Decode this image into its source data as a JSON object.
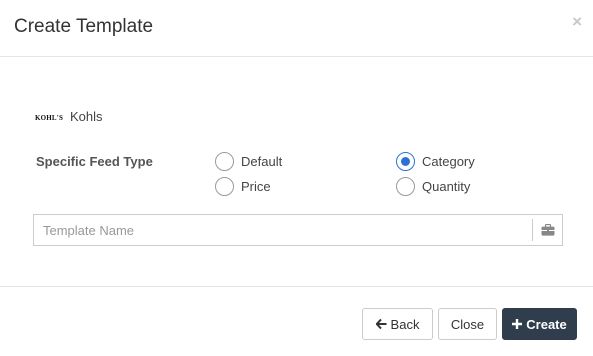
{
  "modal": {
    "title": "Create Template",
    "close_symbol": "×"
  },
  "store": {
    "logo_text": "KOHL'S",
    "name": "Kohls"
  },
  "feed_type": {
    "label": "Specific Feed Type",
    "options": [
      {
        "label": "Default",
        "checked": false
      },
      {
        "label": "Price",
        "checked": false
      },
      {
        "label": "Category",
        "checked": true
      },
      {
        "label": "Quantity",
        "checked": false
      }
    ]
  },
  "template_name": {
    "placeholder": "Template Name",
    "value": "",
    "addon_icon": "briefcase-icon"
  },
  "footer": {
    "back_label": "Back",
    "back_icon": "arrow-left-icon",
    "close_label": "Close",
    "create_label": "Create",
    "create_icon": "plus-icon"
  },
  "colors": {
    "primary_button": "#2f3d4d",
    "radio_checked": "#2b73d2"
  }
}
